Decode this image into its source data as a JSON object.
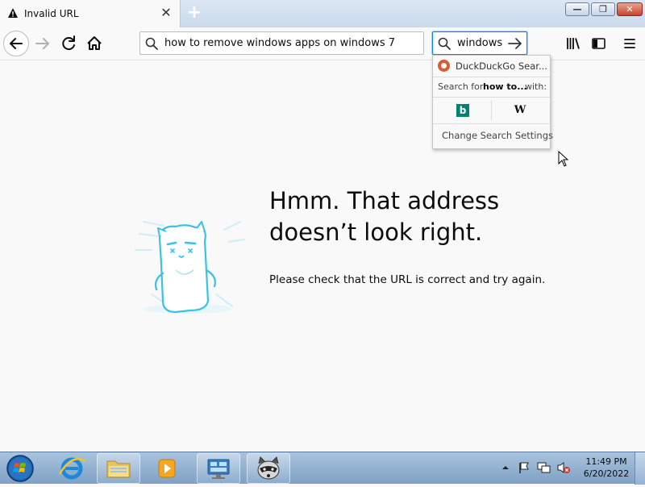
{
  "browser": {
    "tab": {
      "title": "Invalid URL",
      "close_label": "✕",
      "new_tab_label": "+"
    },
    "window_controls": {
      "minimize": "—",
      "maximize": "❐",
      "close": "✕"
    },
    "url_bar": {
      "value": "how to remove windows apps on windows 7"
    },
    "search_bar": {
      "value": "windows"
    }
  },
  "search_popup": {
    "engine_name": "DuckDuckGo Sear...",
    "search_for_prefix": "Search for",
    "search_for_query": "how to...",
    "search_for_suffix": "with:",
    "engines": [
      "bing",
      "wikipedia"
    ],
    "bing_glyph": "b",
    "wiki_glyph": "W",
    "settings_label": "Change Search Settings"
  },
  "error_page": {
    "title": "Hmm. That address doesn’t look right.",
    "message": "Please check that the URL is correct and try again."
  },
  "taskbar": {
    "pinned": [
      "start-orb",
      "internet-explorer",
      "file-explorer",
      "media-player",
      "remote-desktop",
      "firefox-raccoon"
    ],
    "clock_time": "11:49 PM",
    "clock_date": "6/20/2022"
  },
  "colors": {
    "accent_blue": "#0a84ff",
    "bing_teal": "#008373",
    "ddg_orange": "#de5833",
    "illustration_cyan": "#39c1e6"
  }
}
